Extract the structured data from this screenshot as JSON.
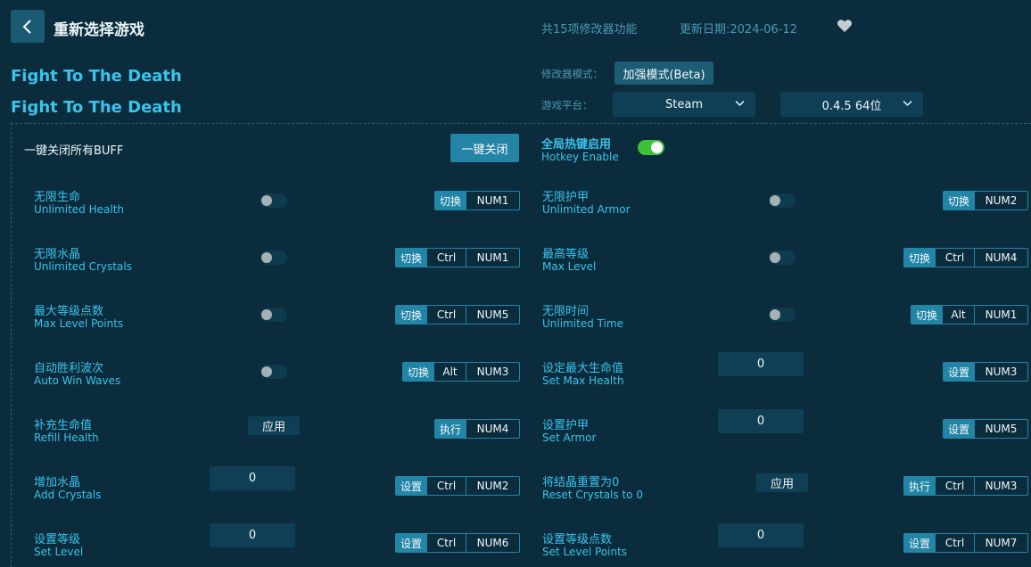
{
  "header": {
    "back_icon": "chevron-left-icon",
    "title": "重新选择游戏",
    "feature_count": "共15项修改器功能",
    "update_date": "更新日期:2024-06-12",
    "favorite_icon": "heart-icon"
  },
  "game": {
    "title_1": "Fight To The Death",
    "title_2": "Fight To The Death"
  },
  "mode": {
    "label": "修改器模式：",
    "value": "加强模式(Beta)"
  },
  "platform": {
    "label": "游戏平台：",
    "selected": "Steam",
    "version": "0.4.5 64位"
  },
  "global": {
    "close_all_label": "一键关闭所有BUFF",
    "close_all_button": "一键关闭",
    "hotkey_title": "全局热键启用",
    "hotkey_sub": "Hotkey Enable",
    "hotkey_enabled": true
  },
  "cheats": [
    {
      "cn": "无限生命",
      "en": "Unlimited Health",
      "control": "toggle",
      "on": false,
      "keys": [
        "切换",
        "NUM1"
      ]
    },
    {
      "cn": "无限护甲",
      "en": "Unlimited Armor",
      "control": "toggle",
      "on": false,
      "keys": [
        "切换",
        "NUM2"
      ]
    },
    {
      "cn": "无限水晶",
      "en": "Unlimited Crystals",
      "control": "toggle",
      "on": false,
      "keys": [
        "切换",
        "Ctrl",
        "NUM1"
      ]
    },
    {
      "cn": "最高等级",
      "en": "Max Level",
      "control": "toggle",
      "on": false,
      "keys": [
        "切换",
        "Ctrl",
        "NUM4"
      ]
    },
    {
      "cn": "最大等级点数",
      "en": "Max Level Points",
      "control": "toggle",
      "on": false,
      "keys": [
        "切换",
        "Ctrl",
        "NUM5"
      ]
    },
    {
      "cn": "无限时间",
      "en": "Unlimited Time",
      "control": "toggle",
      "on": false,
      "keys": [
        "切换",
        "Alt",
        "NUM1"
      ]
    },
    {
      "cn": "自动胜利波次",
      "en": "Auto Win Waves",
      "control": "toggle",
      "on": false,
      "keys": [
        "切换",
        "Alt",
        "NUM3"
      ]
    },
    {
      "cn": "设定最大生命值",
      "en": "Set Max Health",
      "control": "input",
      "value": "0",
      "keys": [
        "设置",
        "NUM3"
      ]
    },
    {
      "cn": "补充生命值",
      "en": "Refill Health",
      "control": "apply",
      "button": "应用",
      "keys": [
        "执行",
        "NUM4"
      ]
    },
    {
      "cn": "设置护甲",
      "en": "Set Armor",
      "control": "input",
      "value": "0",
      "keys": [
        "设置",
        "NUM5"
      ]
    },
    {
      "cn": "增加水晶",
      "en": "Add Crystals",
      "control": "input",
      "value": "0",
      "keys": [
        "设置",
        "Ctrl",
        "NUM2"
      ]
    },
    {
      "cn": "将结晶重置为0",
      "en": "Reset Crystals to 0",
      "control": "apply",
      "button": "应用",
      "keys": [
        "执行",
        "Ctrl",
        "NUM3"
      ]
    },
    {
      "cn": "设置等级",
      "en": "Set Level",
      "control": "input",
      "value": "0",
      "keys": [
        "设置",
        "Ctrl",
        "NUM6"
      ]
    },
    {
      "cn": "设置等级点数",
      "en": "Set Level Points",
      "control": "input",
      "value": "0",
      "keys": [
        "设置",
        "Ctrl",
        "NUM7"
      ]
    }
  ]
}
